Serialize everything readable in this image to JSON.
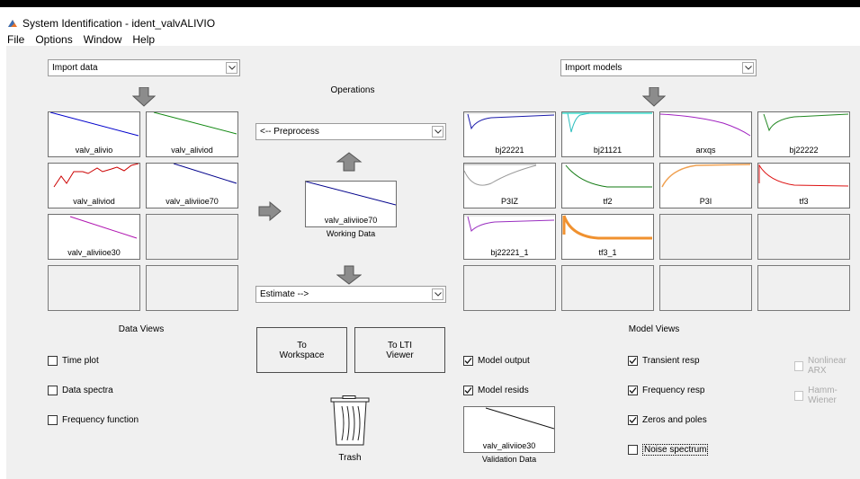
{
  "window": {
    "title": "System Identification - ident_valvALIVIO"
  },
  "menu": [
    "File",
    "Options",
    "Window",
    "Help"
  ],
  "import_data": {
    "selected": "Import data"
  },
  "import_models": {
    "selected": "Import models"
  },
  "operations": {
    "title": "Operations",
    "preprocess": "<-- Preprocess",
    "estimate": "Estimate -->",
    "working_data_name": "valv_aliviioe70",
    "working_data_label": "Working Data"
  },
  "data_slots": [
    "valv_alivio",
    "valv_aliviod",
    "valv_aliviod",
    "valv_aliviioe70",
    "valv_aliviioe30",
    "",
    "",
    ""
  ],
  "model_slots": [
    "bj22221",
    "bj21121",
    "arxqs",
    "bj22222",
    "P3IZ",
    "tf2",
    "P3I",
    "tf3",
    "bj22221_1",
    "tf3_1",
    "",
    "",
    "",
    "",
    "",
    ""
  ],
  "data_views": {
    "title": "Data Views",
    "time_plot": "Time plot",
    "data_spectra": "Data spectra",
    "frequency_function": "Frequency function"
  },
  "buttons": {
    "to_workspace": "To Workspace",
    "to_lti_viewer": "To LTI Viewer"
  },
  "trash": {
    "label": "Trash"
  },
  "validation": {
    "name": "valv_aliviioe30",
    "label": "Validation Data"
  },
  "model_views": {
    "title": "Model Views",
    "model_output": "Model output",
    "model_resids": "Model resids",
    "transient_resp": "Transient resp",
    "frequency_resp": "Frequency resp",
    "zeros_poles": "Zeros and poles",
    "noise_spectrum": "Noise spectrum",
    "nonlinear_arx": "Nonlinear ARX",
    "hamm_wiener": "Hamm-Wiener"
  },
  "checked": {
    "time_plot": false,
    "data_spectra": false,
    "frequency_function": false,
    "model_output": true,
    "model_resids": true,
    "transient_resp": true,
    "frequency_resp": true,
    "zeros_poles": true,
    "noise_spectrum": false,
    "nonlinear_arx": false,
    "hamm_wiener": false
  }
}
